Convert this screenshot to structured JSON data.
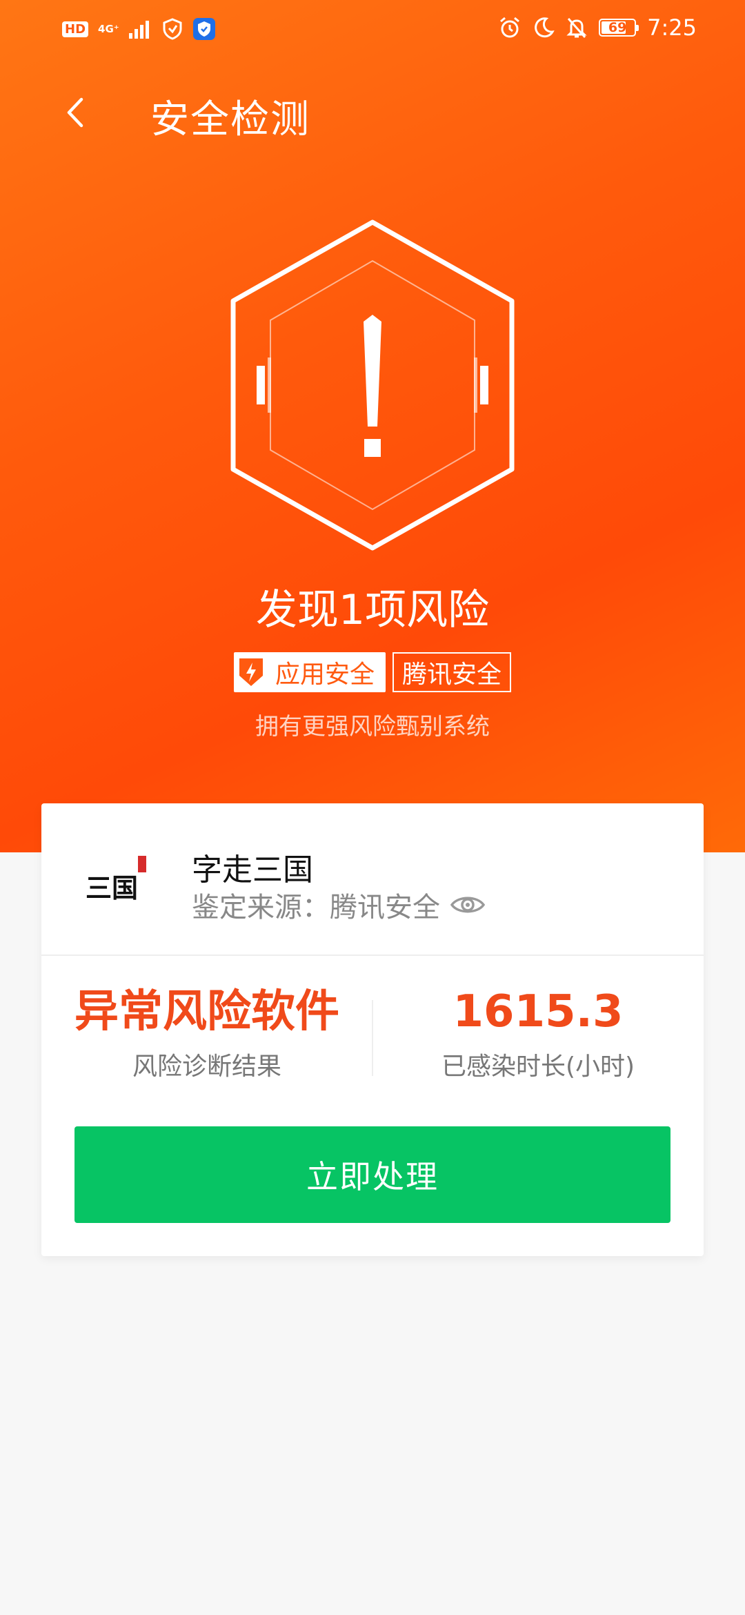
{
  "status_bar": {
    "hd": "HD",
    "network": "4G⁺",
    "battery_level": "69",
    "time": "7:25"
  },
  "header": {
    "title": "安全检测"
  },
  "result": {
    "title": "发现1项风险",
    "tag_app_security": "应用安全",
    "tag_tencent": "腾讯安全",
    "slogan": "拥有更强风险甄别系统"
  },
  "app": {
    "logo_text": "三国",
    "name": "字走三国",
    "source": "鉴定来源：腾讯安全"
  },
  "stats": {
    "diagnosis_value": "异常风险软件",
    "diagnosis_label": "风险诊断结果",
    "infection_value": "1615.3",
    "infection_label": "已感染时长(小时)"
  },
  "action": {
    "button_label": "立即处理"
  },
  "colors": {
    "hero_orange": "#ff5a0c",
    "risk_red": "#f04a1a",
    "action_green": "#07c464"
  }
}
